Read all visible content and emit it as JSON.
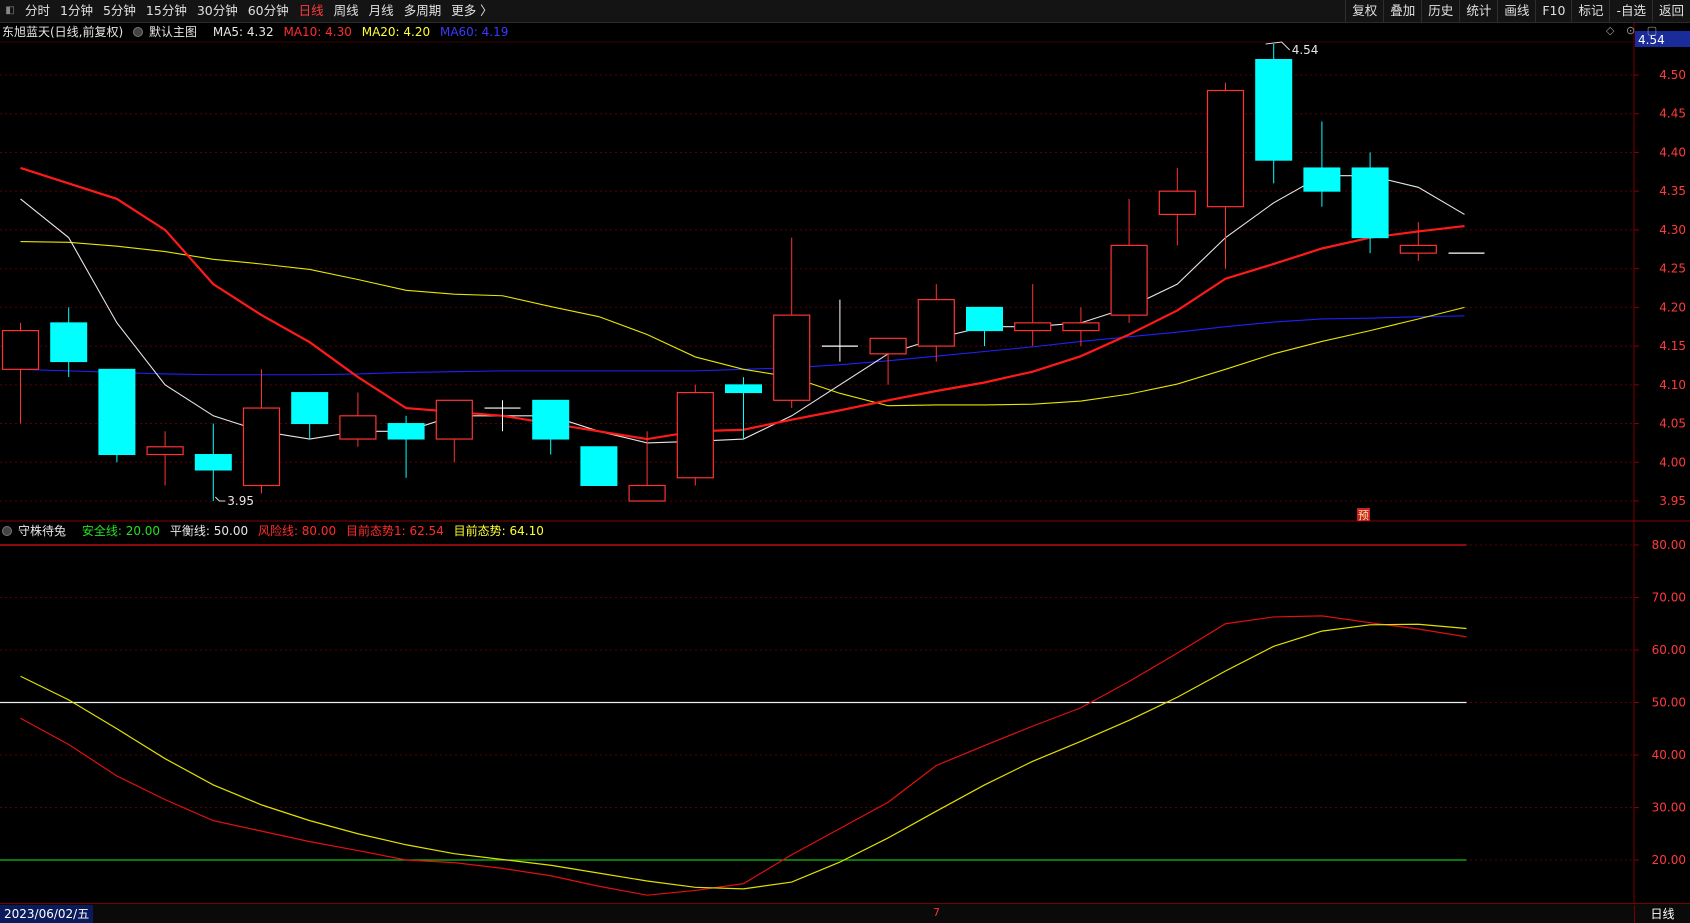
{
  "toolbar": {
    "corner_icon": "◧",
    "periods": [
      "分时",
      "1分钟",
      "5分钟",
      "15分钟",
      "30分钟",
      "60分钟",
      "日线",
      "周线",
      "月线",
      "多周期",
      "更多 〉"
    ],
    "active_period": "日线",
    "actions": [
      "复权",
      "叠加",
      "历史",
      "统计",
      "画线",
      "F10",
      "标记",
      "-自选",
      "返回"
    ]
  },
  "main_legend": {
    "stock": "东旭蓝天(日线,前复权)",
    "template": "默认主图",
    "ma5": "MA5: 4.32",
    "ma10": "MA10: 4.30",
    "ma20": "MA20: 4.20",
    "ma60": "MA60: 4.19"
  },
  "header_icons": [
    "◇",
    "⊙",
    "▢"
  ],
  "price_axis": {
    "current_price": "4.54",
    "ticks": [
      "4.50",
      "4.45",
      "4.40",
      "4.35",
      "4.30",
      "4.25",
      "4.20",
      "4.15",
      "4.10",
      "4.05",
      "4.00",
      "3.95"
    ]
  },
  "annotations": {
    "high": "4.54",
    "low": "3.95",
    "forecast_badge": "预"
  },
  "indicator_legend": {
    "name": "守株待兔",
    "safe": "安全线: 20.00",
    "balance": "平衡线: 50.00",
    "risk": "风险线: 80.00",
    "trend1": "目前态势1: 62.54",
    "trend2": "目前态势: 64.10"
  },
  "indicator_axis": {
    "ticks": [
      "80.00",
      "70.00",
      "60.00",
      "50.00",
      "40.00",
      "30.00",
      "20.00"
    ]
  },
  "bottom": {
    "date": "2023/06/02/五",
    "mid_mark": "7",
    "period": "日线"
  },
  "colors": {
    "up": "#ff3232",
    "down": "#00ffff",
    "ma5": "#e6e6e6",
    "ma10": "#ff1a1a",
    "ma20": "#e6e600",
    "ma60": "#2020ff"
  },
  "chart_data": [
    {
      "type": "candlestick",
      "title": "东旭蓝天(日线,前复权)",
      "ylim": [
        3.93,
        4.56
      ],
      "candles": [
        {
          "o": 4.12,
          "h": 4.18,
          "l": 4.05,
          "c": 4.17
        },
        {
          "o": 4.18,
          "h": 4.2,
          "l": 4.11,
          "c": 4.13
        },
        {
          "o": 4.12,
          "h": 4.12,
          "l": 4.0,
          "c": 4.01
        },
        {
          "o": 4.01,
          "h": 4.04,
          "l": 3.97,
          "c": 4.02
        },
        {
          "o": 4.01,
          "h": 4.05,
          "l": 3.95,
          "c": 3.99
        },
        {
          "o": 3.97,
          "h": 4.12,
          "l": 3.96,
          "c": 4.07
        },
        {
          "o": 4.09,
          "h": 4.09,
          "l": 4.03,
          "c": 4.05
        },
        {
          "o": 4.03,
          "h": 4.09,
          "l": 4.02,
          "c": 4.06
        },
        {
          "o": 4.05,
          "h": 4.06,
          "l": 3.98,
          "c": 4.03
        },
        {
          "o": 4.03,
          "h": 4.08,
          "l": 4.0,
          "c": 4.08
        },
        {
          "o": 4.07,
          "h": 4.08,
          "l": 4.04,
          "c": 4.07
        },
        {
          "o": 4.08,
          "h": 4.08,
          "l": 4.01,
          "c": 4.03
        },
        {
          "o": 4.02,
          "h": 4.02,
          "l": 3.97,
          "c": 3.97
        },
        {
          "o": 3.95,
          "h": 4.04,
          "l": 3.95,
          "c": 3.97
        },
        {
          "o": 3.98,
          "h": 4.1,
          "l": 3.97,
          "c": 4.09
        },
        {
          "o": 4.1,
          "h": 4.11,
          "l": 4.03,
          "c": 4.09
        },
        {
          "o": 4.08,
          "h": 4.29,
          "l": 4.07,
          "c": 4.19
        },
        {
          "o": 4.15,
          "h": 4.21,
          "l": 4.13,
          "c": 4.15
        },
        {
          "o": 4.14,
          "h": 4.16,
          "l": 4.1,
          "c": 4.16
        },
        {
          "o": 4.15,
          "h": 4.23,
          "l": 4.13,
          "c": 4.21
        },
        {
          "o": 4.2,
          "h": 4.2,
          "l": 4.15,
          "c": 4.17
        },
        {
          "o": 4.17,
          "h": 4.23,
          "l": 4.15,
          "c": 4.18
        },
        {
          "o": 4.17,
          "h": 4.2,
          "l": 4.15,
          "c": 4.18
        },
        {
          "o": 4.19,
          "h": 4.34,
          "l": 4.18,
          "c": 4.28
        },
        {
          "o": 4.32,
          "h": 4.38,
          "l": 4.28,
          "c": 4.35
        },
        {
          "o": 4.33,
          "h": 4.49,
          "l": 4.25,
          "c": 4.48
        },
        {
          "o": 4.52,
          "h": 4.54,
          "l": 4.36,
          "c": 4.39
        },
        {
          "o": 4.38,
          "h": 4.44,
          "l": 4.33,
          "c": 4.35
        },
        {
          "o": 4.38,
          "h": 4.4,
          "l": 4.27,
          "c": 4.29
        },
        {
          "o": 4.27,
          "h": 4.31,
          "l": 4.26,
          "c": 4.28
        },
        {
          "o": 4.27,
          "h": 4.27,
          "l": 4.27,
          "c": 4.27
        }
      ],
      "ma5": [
        4.34,
        4.29,
        4.18,
        4.1,
        4.06,
        4.04,
        4.03,
        4.04,
        4.04,
        4.06,
        4.06,
        4.06,
        4.04,
        4.025,
        4.027,
        4.03,
        4.06,
        4.1,
        4.14,
        4.16,
        4.175,
        4.175,
        4.18,
        4.2,
        4.23,
        4.29,
        4.335,
        4.37,
        4.37,
        4.355,
        4.32
      ],
      "ma10": [
        4.38,
        4.36,
        4.34,
        4.3,
        4.23,
        4.19,
        4.155,
        4.11,
        4.07,
        4.065,
        4.06,
        4.05,
        4.04,
        4.03,
        4.04,
        4.042,
        4.055,
        4.067,
        4.08,
        4.092,
        4.103,
        4.117,
        4.137,
        4.165,
        4.196,
        4.237,
        4.256,
        4.276,
        4.29,
        4.298,
        4.305
      ],
      "ma20": [
        4.285,
        4.284,
        4.279,
        4.272,
        4.262,
        4.256,
        4.249,
        4.236,
        4.222,
        4.217,
        4.215,
        4.201,
        4.188,
        4.165,
        4.136,
        4.12,
        4.11,
        4.089,
        4.073,
        4.074,
        4.074,
        4.075,
        4.079,
        4.088,
        4.101,
        4.12,
        4.14,
        4.156,
        4.17,
        4.185,
        4.2,
        4.2
      ],
      "ma60": [
        4.12,
        4.118,
        4.116,
        4.114,
        4.113,
        4.113,
        4.113,
        4.114,
        4.116,
        4.117,
        4.118,
        4.118,
        4.118,
        4.118,
        4.118,
        4.12,
        4.122,
        4.126,
        4.131,
        4.137,
        4.143,
        4.149,
        4.156,
        4.162,
        4.168,
        4.175,
        4.181,
        4.185,
        4.186,
        4.188,
        4.189
      ]
    },
    {
      "type": "line",
      "title": "守株待兔",
      "ylim": [
        12,
        84
      ],
      "hlines": {
        "risk": 80,
        "balance": 50,
        "safe": 20
      },
      "series": [
        {
          "name": "目前态势1",
          "values": [
            47,
            42,
            36,
            31.5,
            27.5,
            25.5,
            23.5,
            21.8,
            20,
            19.5,
            18.4,
            17,
            15,
            13.3,
            14.2,
            15.5,
            21,
            26,
            31,
            38,
            41.8,
            45.5,
            49,
            54,
            59.4,
            65,
            66.3,
            66.5,
            65.2,
            64,
            62.5
          ]
        },
        {
          "name": "目前态势",
          "values": [
            55,
            50.5,
            45,
            39.3,
            34.3,
            30.5,
            27.5,
            25,
            22.9,
            21.2,
            20.1,
            19,
            17.5,
            16,
            14.8,
            14.5,
            15.8,
            19.6,
            24.2,
            29.3,
            34.3,
            38.8,
            42.6,
            46.6,
            51,
            56,
            60.7,
            63.6,
            64.8,
            64.9,
            64.1
          ]
        }
      ]
    }
  ]
}
